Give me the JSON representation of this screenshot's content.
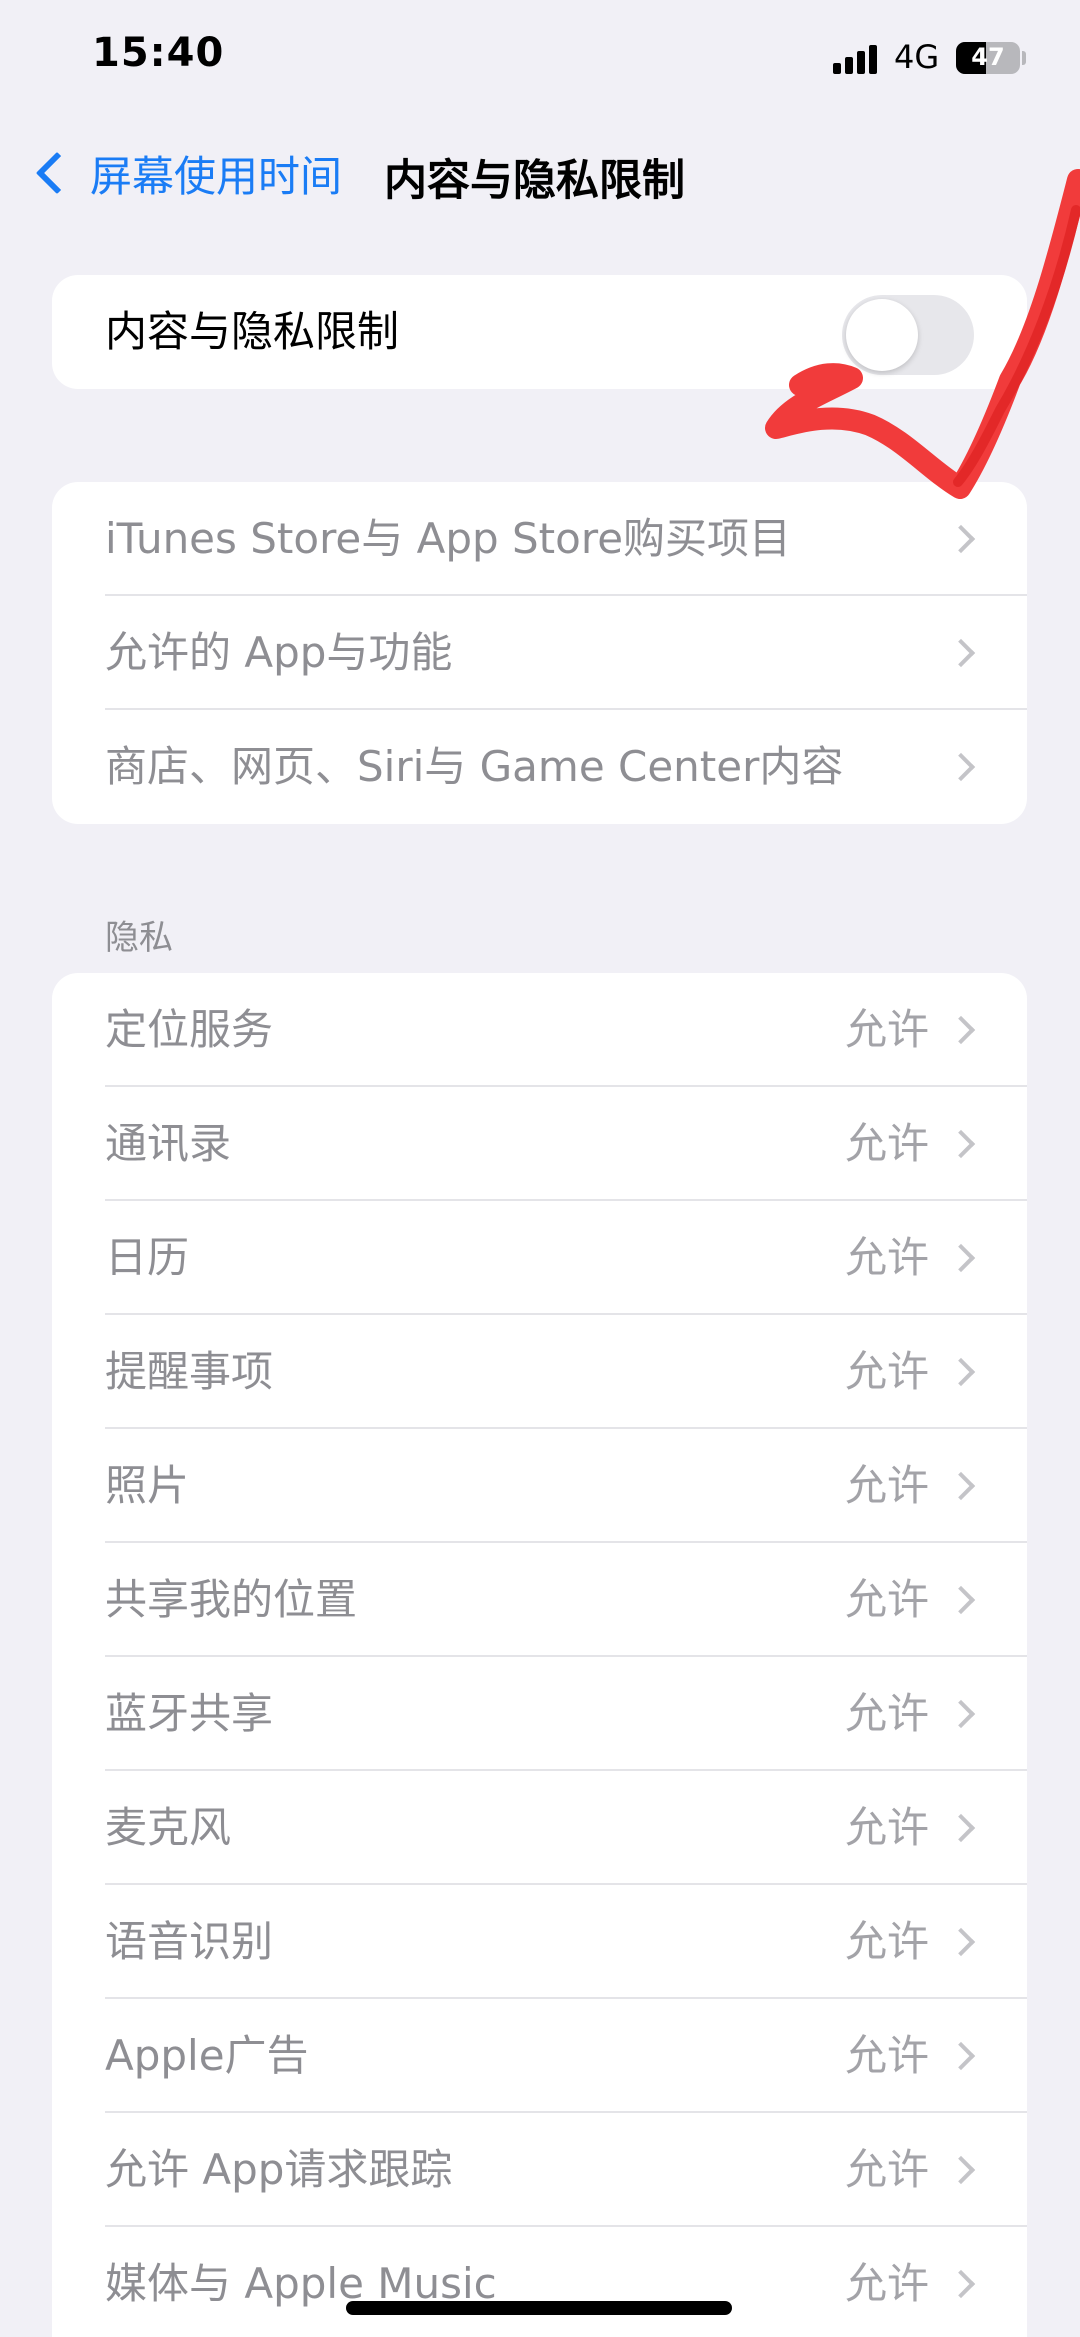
{
  "status_bar": {
    "time": "15:40",
    "network": "4G",
    "battery_level": "47",
    "battery_percent": 47
  },
  "nav": {
    "back_label": "屏幕使用时间",
    "title": "内容与隐私限制"
  },
  "master_toggle": {
    "label": "内容与隐私限制",
    "on": false
  },
  "store_section": {
    "items": [
      {
        "label": "iTunes Store与 App Store购买项目"
      },
      {
        "label": "允许的 App与功能"
      },
      {
        "label": "商店、网页、Siri与 Game Center内容"
      }
    ]
  },
  "privacy_section": {
    "header": "隐私",
    "items": [
      {
        "label": "定位服务",
        "value": "允许"
      },
      {
        "label": "通讯录",
        "value": "允许"
      },
      {
        "label": "日历",
        "value": "允许"
      },
      {
        "label": "提醒事项",
        "value": "允许"
      },
      {
        "label": "照片",
        "value": "允许"
      },
      {
        "label": "共享我的位置",
        "value": "允许"
      },
      {
        "label": "蓝牙共享",
        "value": "允许"
      },
      {
        "label": "麦克风",
        "value": "允许"
      },
      {
        "label": "语音识别",
        "value": "允许"
      },
      {
        "label": "Apple广告",
        "value": "允许"
      },
      {
        "label": "允许 App请求跟踪",
        "value": "允许"
      },
      {
        "label": "媒体与 Apple Music",
        "value": "允许"
      }
    ]
  },
  "colors": {
    "accent": "#1a7cf5",
    "background": "#f1f0f6",
    "annotation": "#f03030"
  }
}
